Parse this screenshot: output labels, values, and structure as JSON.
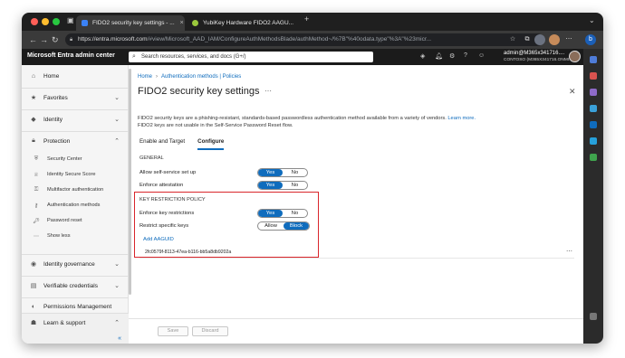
{
  "browser": {
    "tabs": [
      {
        "title": "FIDO2 security key settings - ...",
        "active": true
      },
      {
        "title": "YubiKey Hardware FIDO2 AAGU...",
        "active": false
      }
    ],
    "new_tab_glyph": "+",
    "url_host": "https://entra.microsoft.com",
    "url_path": "/#view/Microsoft_AAD_IAM/ConfigureAuthMethodsBlade/authMethod~/%7B\"%40odata.type\"%3A\"%23micr..."
  },
  "portal": {
    "brand": "Microsoft Entra admin center",
    "search_placeholder": "Search resources, services, and docs (G+/)",
    "account_name": "admin@M365x341716....",
    "account_org": "CONTOSO (M365X341716.ONMI..."
  },
  "nav": {
    "home": "Home",
    "favorites": "Favorites",
    "identity": "Identity",
    "protection": "Protection",
    "protection_items": [
      "Security Center",
      "Identity Secure Score",
      "Multifactor authentication",
      "Authentication methods",
      "Password reset",
      "Show less"
    ],
    "identity_governance": "Identity governance",
    "verifiable_credentials": "Verifiable credentials",
    "permissions_management": "Permissions Management",
    "learn_support": "Learn & support",
    "collapse_glyph": "«"
  },
  "content": {
    "breadcrumb": [
      "Home",
      "Authentication methods | Policies"
    ],
    "title": "FIDO2 security key settings",
    "description_1": "FIDO2 security keys are a phishing-resistant, standards-based passwordless authentication method available from a variety of vendors.",
    "learn_more": "Learn more.",
    "description_2": "FIDO2 keys are not usable in the Self-Service Password Reset flow.",
    "tabs": [
      "Enable and Target",
      "Configure"
    ],
    "general_label": "GENERAL",
    "allow_self_service": "Allow self-service set up",
    "enforce_attestation": "Enforce attestation",
    "key_restriction_label": "KEY RESTRICTION POLICY",
    "enforce_key_restrictions": "Enforce key restrictions",
    "restrict_specific_keys": "Restrict specific keys",
    "toggle_yes": "Yes",
    "toggle_no": "No",
    "toggle_allow": "Allow",
    "toggle_block": "Block",
    "add_aaguid": "Add AAGUID",
    "aaguid_value": "2fc0579f-8113-47ea-b116-bb5a8db9202a",
    "save": "Save",
    "discard": "Discard"
  },
  "toggles": {
    "allow_self_service": "Yes",
    "enforce_attestation": "Yes",
    "enforce_key_restrictions": "Yes",
    "restrict_specific_keys": "Block"
  },
  "colors": {
    "accent": "#0f6cbd",
    "highlight_box": "#d9262c",
    "portal_header": "#1b1b1b"
  }
}
